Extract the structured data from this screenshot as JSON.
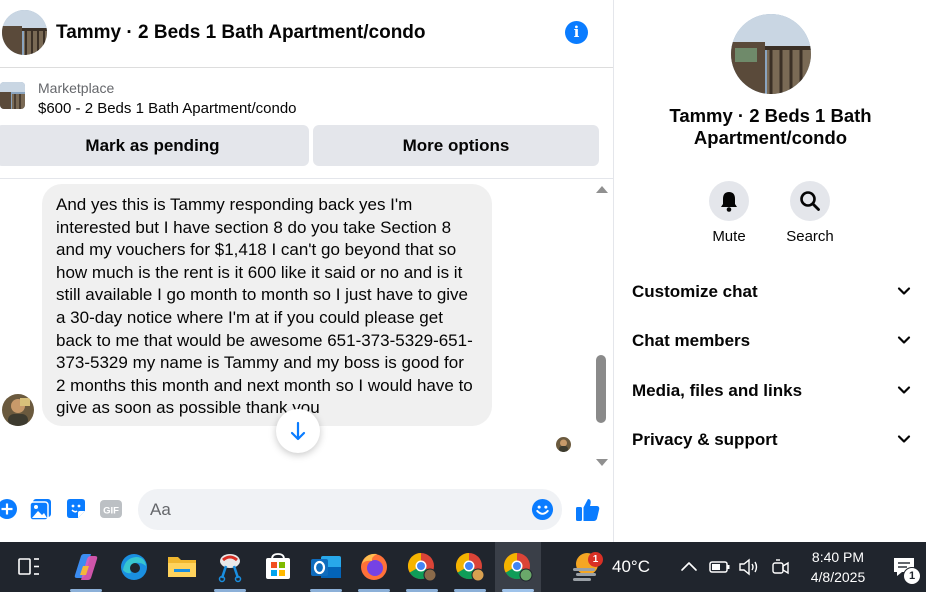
{
  "header": {
    "title": "Tammy · 2 Beds 1 Bath Apartment/condo",
    "info_icon": "info-icon"
  },
  "marketplace": {
    "label": "Marketplace",
    "listing": "$600 - 2 Beds 1 Bath Apartment/condo",
    "buttons": {
      "pending": "Mark as pending",
      "more": "More options"
    }
  },
  "message": {
    "text": "And yes this is Tammy responding back yes I'm interested but I have section 8 do you take Section 8 and my vouchers for $1,418 I can't go beyond that so how much is the rent is it 600 like it said or no and is it still available I go month to month so I just have to give a 30-day notice where I'm at if you could please get back to me that would be awesome 651-373-5329-651-373-5329 my name is Tammy and my boss is good for 2 months this month and next month so I would have to give as soon as possible thank you"
  },
  "composer": {
    "placeholder": "Aa",
    "icons": [
      "plus-icon",
      "photo-icon",
      "sticker-icon",
      "gif-icon",
      "emoji-icon",
      "like-icon"
    ],
    "gif_label": "GIF"
  },
  "details": {
    "name": "Tammy · 2 Beds 1 Bath Apartment/condo",
    "actions": {
      "mute": "Mute",
      "search": "Search"
    },
    "sections": [
      {
        "label": "Customize chat"
      },
      {
        "label": "Chat members"
      },
      {
        "label": "Media, files and links"
      },
      {
        "label": "Privacy & support"
      }
    ]
  },
  "taskbar": {
    "weather_temp": "40°C",
    "weather_badge": "1",
    "time": "8:40 PM",
    "date": "4/8/2025",
    "notification_count": "1"
  },
  "colors": {
    "accent": "#0a7cff",
    "bubble_bg": "#f0f0f0",
    "button_bg": "#e4e6eb",
    "taskbar_bg": "#20252d"
  }
}
